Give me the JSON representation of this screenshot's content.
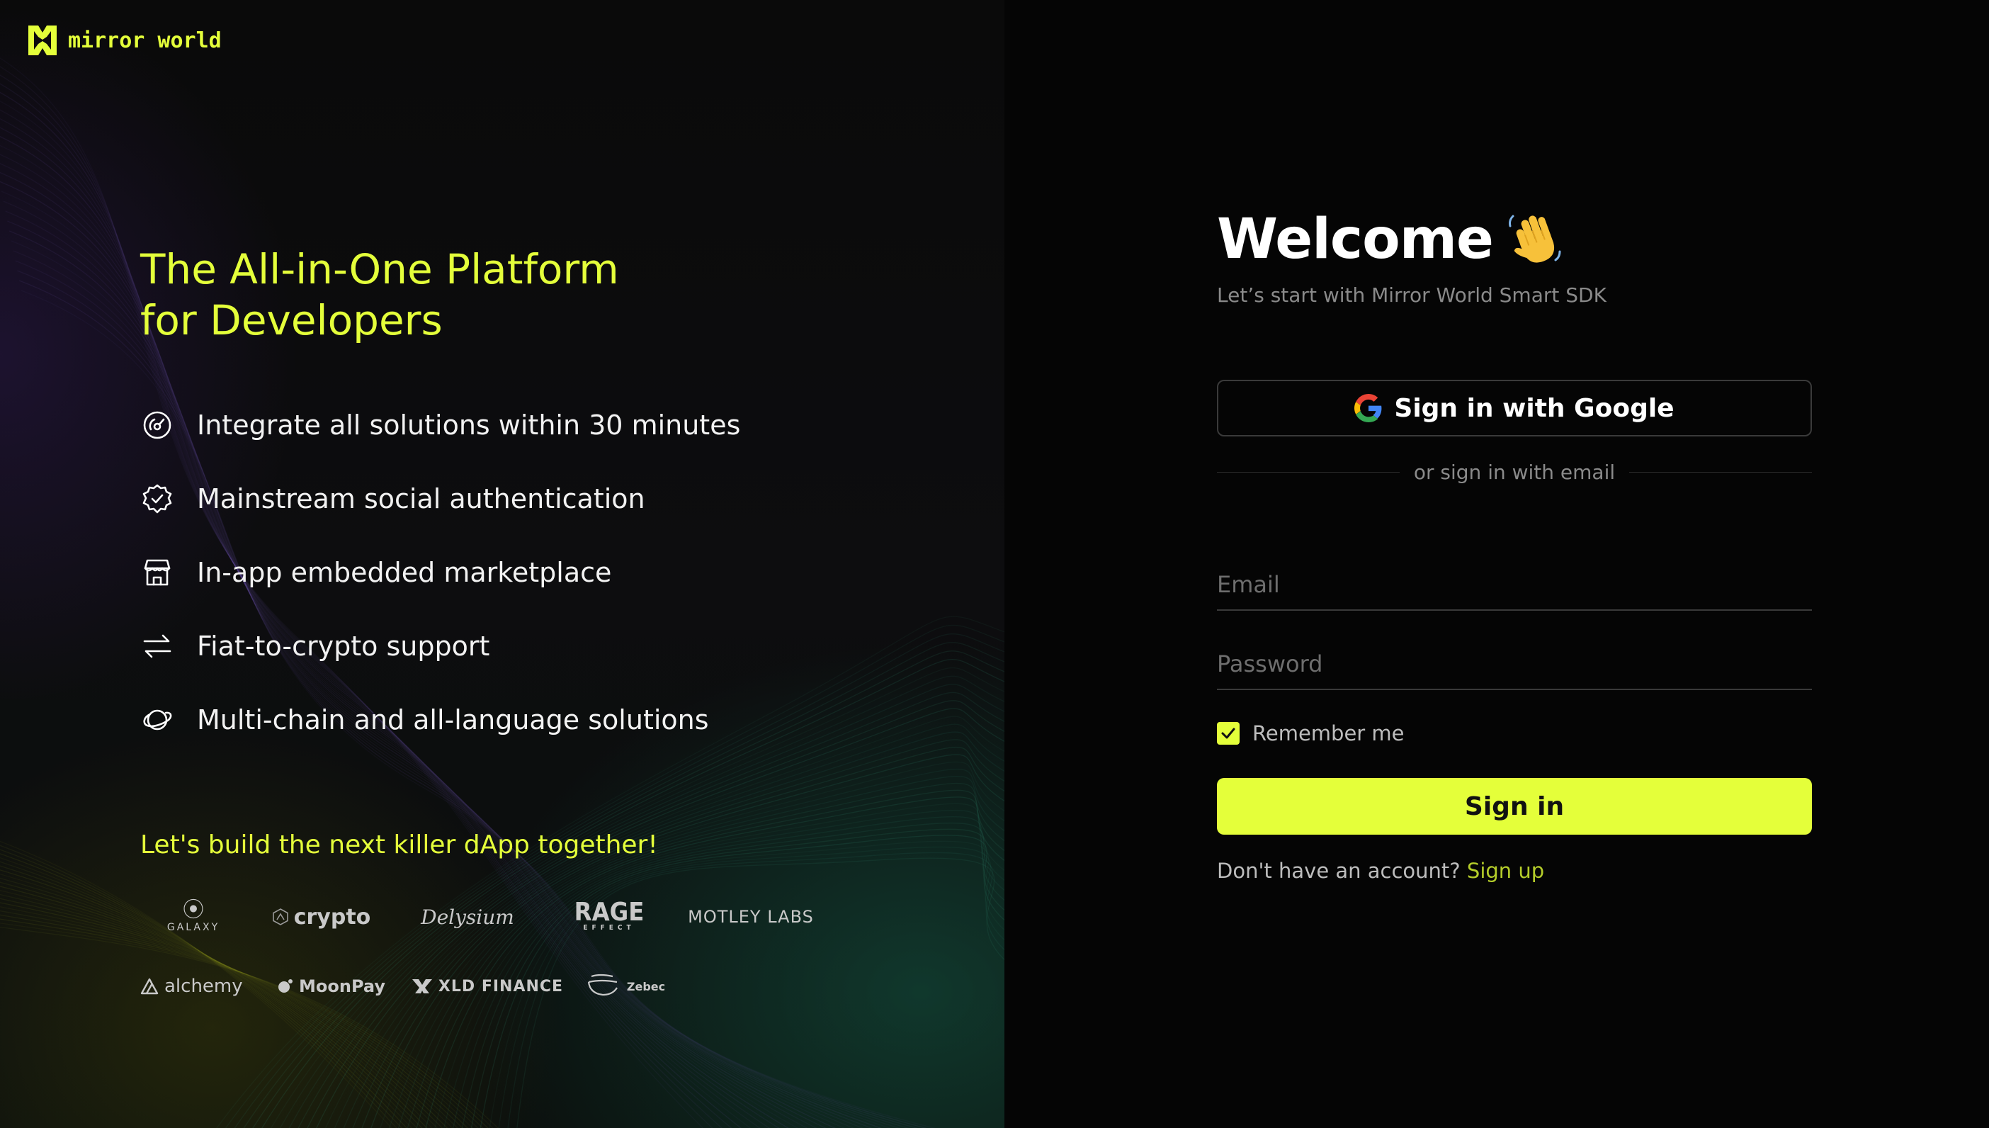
{
  "brand": {
    "name": "mirror world",
    "accent_color": "#e4ff3a"
  },
  "left": {
    "headline_line1": "The All-in-One Platform",
    "headline_line2": "for Developers",
    "features": [
      {
        "icon": "gauge-icon",
        "label": "Integrate all solutions within 30 minutes"
      },
      {
        "icon": "verified-badge-icon",
        "label": "Mainstream social authentication"
      },
      {
        "icon": "storefront-icon",
        "label": "In-app embedded marketplace"
      },
      {
        "icon": "swap-arrows-icon",
        "label": "Fiat-to-crypto support"
      },
      {
        "icon": "planet-icon",
        "label": "Multi-chain and all-language solutions"
      }
    ],
    "tagline": "Let's build the next killer dApp together!",
    "partners_row1": {
      "galaxy": "GALAXY",
      "crypto": "crypto",
      "delysium": "Delysium",
      "rage": "RAGE",
      "rage_sub": "EFFECT",
      "motley": "MOTLEY LABS"
    },
    "partners_row2": {
      "alchemy": "alchemy",
      "moonpay": "MoonPay",
      "xld": "XLD FINANCE",
      "zebec": "Zebec"
    }
  },
  "right": {
    "welcome_title": "Welcome",
    "subtitle": "Let’s start with Mirror World Smart SDK",
    "google_button": "Sign in with Google",
    "divider_text": "or sign in with email",
    "email_placeholder": "Email",
    "password_placeholder": "Password",
    "remember_label": "Remember me",
    "remember_checked": true,
    "signin_button": "Sign in",
    "signup_prompt": "Don't have an account?",
    "signup_link": "Sign up"
  }
}
